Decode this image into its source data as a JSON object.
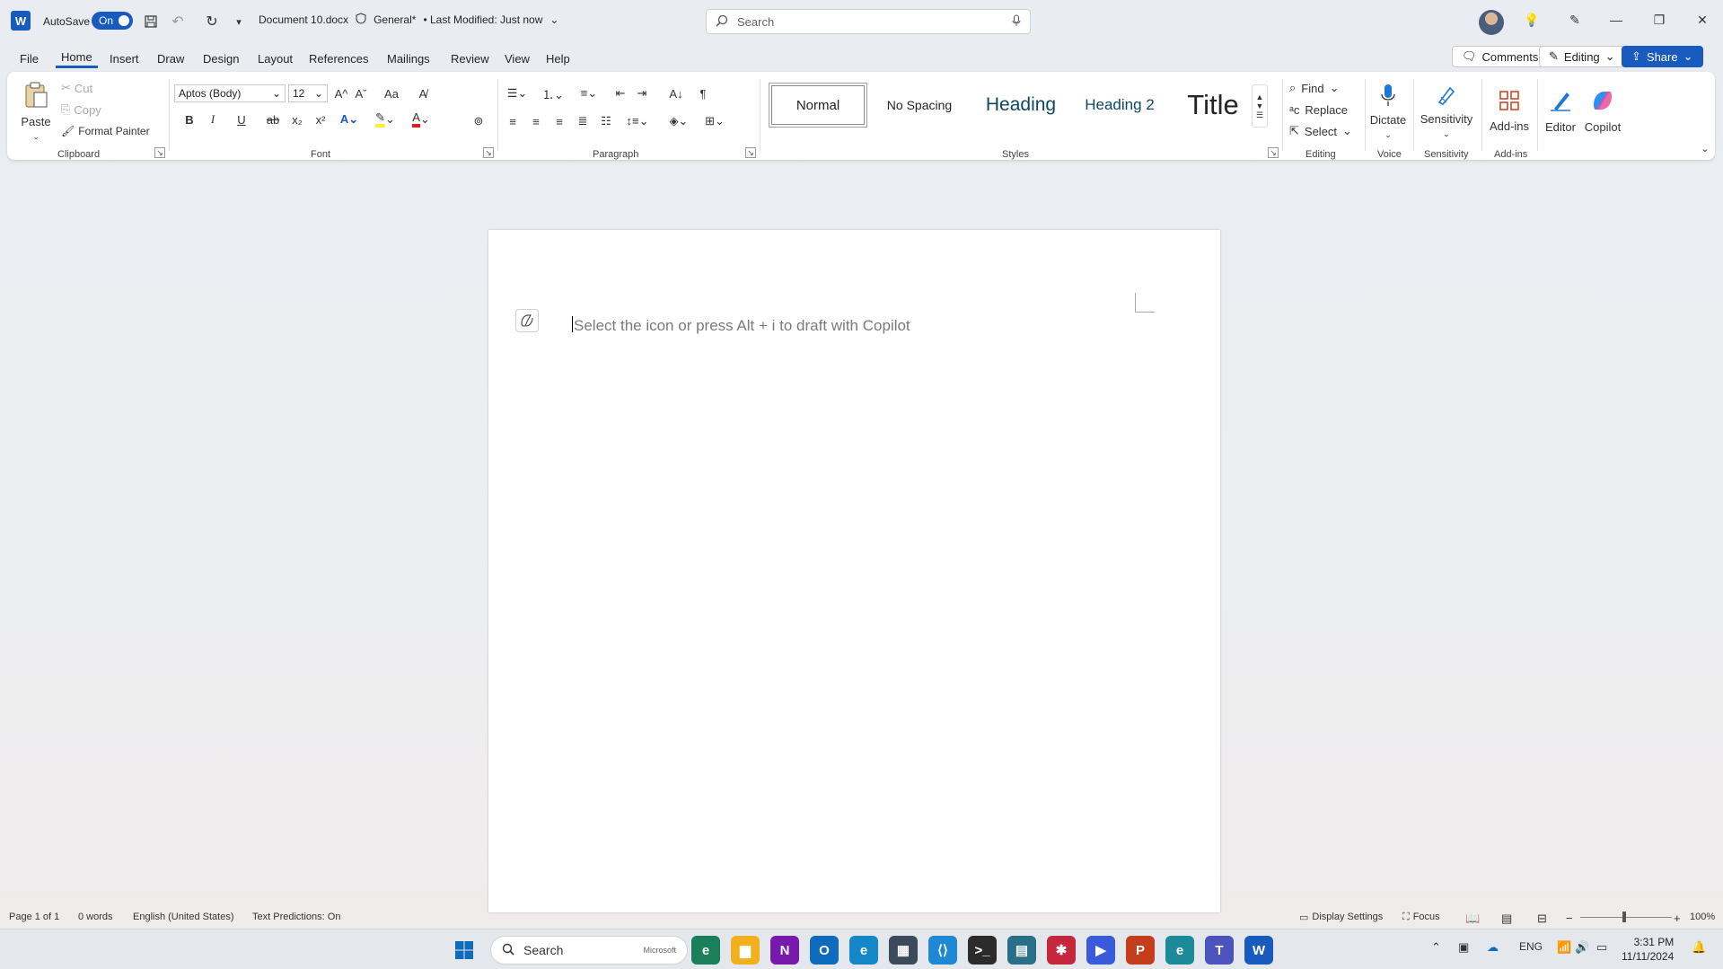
{
  "titlebar": {
    "app_icon": "W",
    "autosave_label": "AutoSave",
    "autosave_state": "On",
    "document_name": "Document 10.docx",
    "sensitivity": "General*",
    "modified": "• Last Modified: Just now",
    "search_placeholder": "Search"
  },
  "tabs": [
    "File",
    "Home",
    "Insert",
    "Draw",
    "Design",
    "Layout",
    "References",
    "Mailings",
    "Review",
    "View",
    "Help"
  ],
  "topright": {
    "comments_label": "Comments",
    "editing_label": "Editing",
    "share_label": "Share"
  },
  "ribbon": {
    "clipboard": {
      "paste": "Paste",
      "cut": "Cut",
      "copy": "Copy",
      "format_painter": "Format Painter",
      "group_label": "Clipboard"
    },
    "font": {
      "font_name": "Aptos (Body)",
      "font_size": "12",
      "bold": "B",
      "italic": "I",
      "underline": "U",
      "strike": "ab",
      "subscript": "x₂",
      "superscript": "x²",
      "grow": "A^",
      "shrink": "Aˇ",
      "case": "Aa",
      "group_label": "Font"
    },
    "paragraph": {
      "group_label": "Paragraph",
      "pilcrow": "¶"
    },
    "styles": {
      "items": [
        "Normal",
        "No Spacing",
        "Heading",
        "Heading 2",
        "Title"
      ],
      "group_label": "Styles"
    },
    "editing": {
      "find": "Find",
      "replace": "Replace",
      "select": "Select",
      "group_label": "Editing"
    },
    "voice": {
      "dictate": "Dictate",
      "group_label": "Voice"
    },
    "sensitivity": {
      "label": "Sensitivity",
      "group_label": "Sensitivity"
    },
    "addins": {
      "label": "Add-ins",
      "group_label": "Add-ins"
    },
    "editor": {
      "label": "Editor"
    },
    "copilot": {
      "label": "Copilot"
    }
  },
  "document": {
    "copilot_prompt": "Select the icon or press Alt + i to draft with Copilot"
  },
  "statusbar": {
    "page": "Page 1 of 1",
    "words": "0 words",
    "language": "English (United States)",
    "predictions": "Text Predictions: On",
    "display_settings": "Display Settings",
    "focus": "Focus",
    "zoom_minus": "−",
    "zoom_plus": "+",
    "zoom_level": "100%"
  },
  "taskbar": {
    "search_label": "Search",
    "search_badge": "Microsoft",
    "language": "ENG",
    "time": "3:31 PM",
    "date": "11/11/2024",
    "apps": [
      {
        "name": "edge-dev",
        "color": "#1a7f5a",
        "glyph": "e"
      },
      {
        "name": "file-explorer",
        "color": "#f2b01e",
        "glyph": "▆"
      },
      {
        "name": "onenote",
        "color": "#7719aa",
        "glyph": "N"
      },
      {
        "name": "outlook",
        "color": "#0f6cbd",
        "glyph": "O"
      },
      {
        "name": "edge",
        "color": "#1387c8",
        "glyph": "e"
      },
      {
        "name": "snipping",
        "color": "#3b4a5c",
        "glyph": "▦"
      },
      {
        "name": "vscode",
        "color": "#1e88d2",
        "glyph": "⟨⟩"
      },
      {
        "name": "terminal",
        "color": "#2b2b2b",
        "glyph": ">_"
      },
      {
        "name": "paint",
        "color": "#2a6f8a",
        "glyph": "▤"
      },
      {
        "name": "app-red",
        "color": "#c5283d",
        "glyph": "✱"
      },
      {
        "name": "media-player",
        "color": "#3a5bd9",
        "glyph": "▶"
      },
      {
        "name": "powerpoint",
        "color": "#c43e1c",
        "glyph": "P"
      },
      {
        "name": "edge-beta",
        "color": "#1d8a9a",
        "glyph": "e"
      },
      {
        "name": "teams",
        "color": "#4b53bc",
        "glyph": "T"
      },
      {
        "name": "word",
        "color": "#185abd",
        "glyph": "W"
      }
    ]
  }
}
